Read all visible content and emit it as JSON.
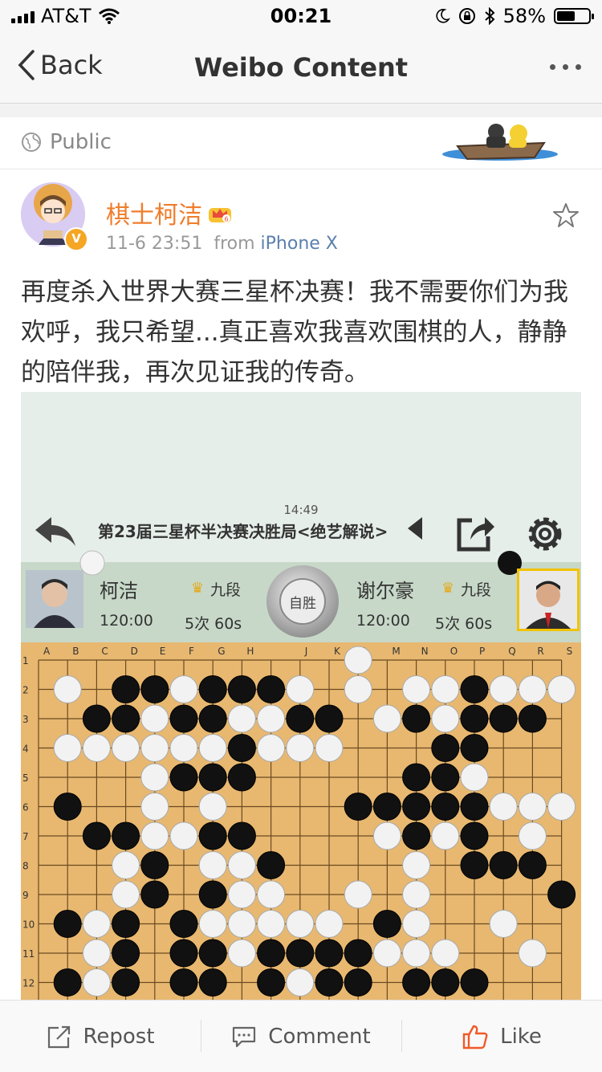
{
  "status_bar": {
    "carrier": "AT&T",
    "time": "00:21",
    "battery": "58%",
    "battery_level": 0.58
  },
  "nav": {
    "back_label": "Back",
    "title": "Weibo Content"
  },
  "visibility": {
    "label": "Public"
  },
  "post": {
    "username": "棋士柯洁",
    "time": "11-6 23:51",
    "from_label": "from",
    "source": "iPhone X",
    "verified_mark": "V",
    "text": "再度杀入世界大赛三星杯决赛！我不需要你们为我欢呼，我只希望...真正喜欢我喜欢围棋的人，静静的陪伴我，再次见证我的传奇。"
  },
  "game": {
    "clock": "14:49",
    "title": "第23届三星杯半决赛决胜局<绝艺解说>",
    "resign_label": "自胜",
    "player_left": {
      "name": "柯洁",
      "rank": "九段",
      "time": "120:00",
      "byoyomi": "5次 60s",
      "stone": "white"
    },
    "player_right": {
      "name": "谢尔豪",
      "rank": "九段",
      "time": "120:00",
      "byoyomi": "5次 60s",
      "stone": "black"
    },
    "columns": [
      "A",
      "B",
      "C",
      "D",
      "E",
      "F",
      "G",
      "H",
      "J",
      "K",
      "L",
      "M",
      "N",
      "O",
      "P",
      "Q",
      "R",
      "S"
    ],
    "rows": [
      "1",
      "2",
      "3",
      "4",
      "5",
      "6",
      "7",
      "8",
      "9",
      "10",
      "11",
      "12"
    ],
    "board_rows": [
      "...........W......",
      ".W.BBWBBBW.W.WWBWWW",
      "..BBWBBWWBB.WBWBBB",
      ".WWWWWWBWWW...BB..",
      "....WBBB.....BBW..",
      ".B..W.W....BBBBBWWW",
      "..BBWWBB....WBWB.W.",
      "...WB.WWB....W.BBB.",
      "...WB.BWW..W.W....B",
      ".BWB.BWWWWW.BW..W..",
      "..WB.BBWBBBBWWW..W.",
      ".BWB.BB.BWBB.BBB..."
    ]
  },
  "actions": {
    "repost": "Repost",
    "comment": "Comment",
    "like": "Like"
  },
  "colors": {
    "username": "#f07d2b",
    "source": "#5b7fae",
    "like_icon": "#f05a28"
  }
}
